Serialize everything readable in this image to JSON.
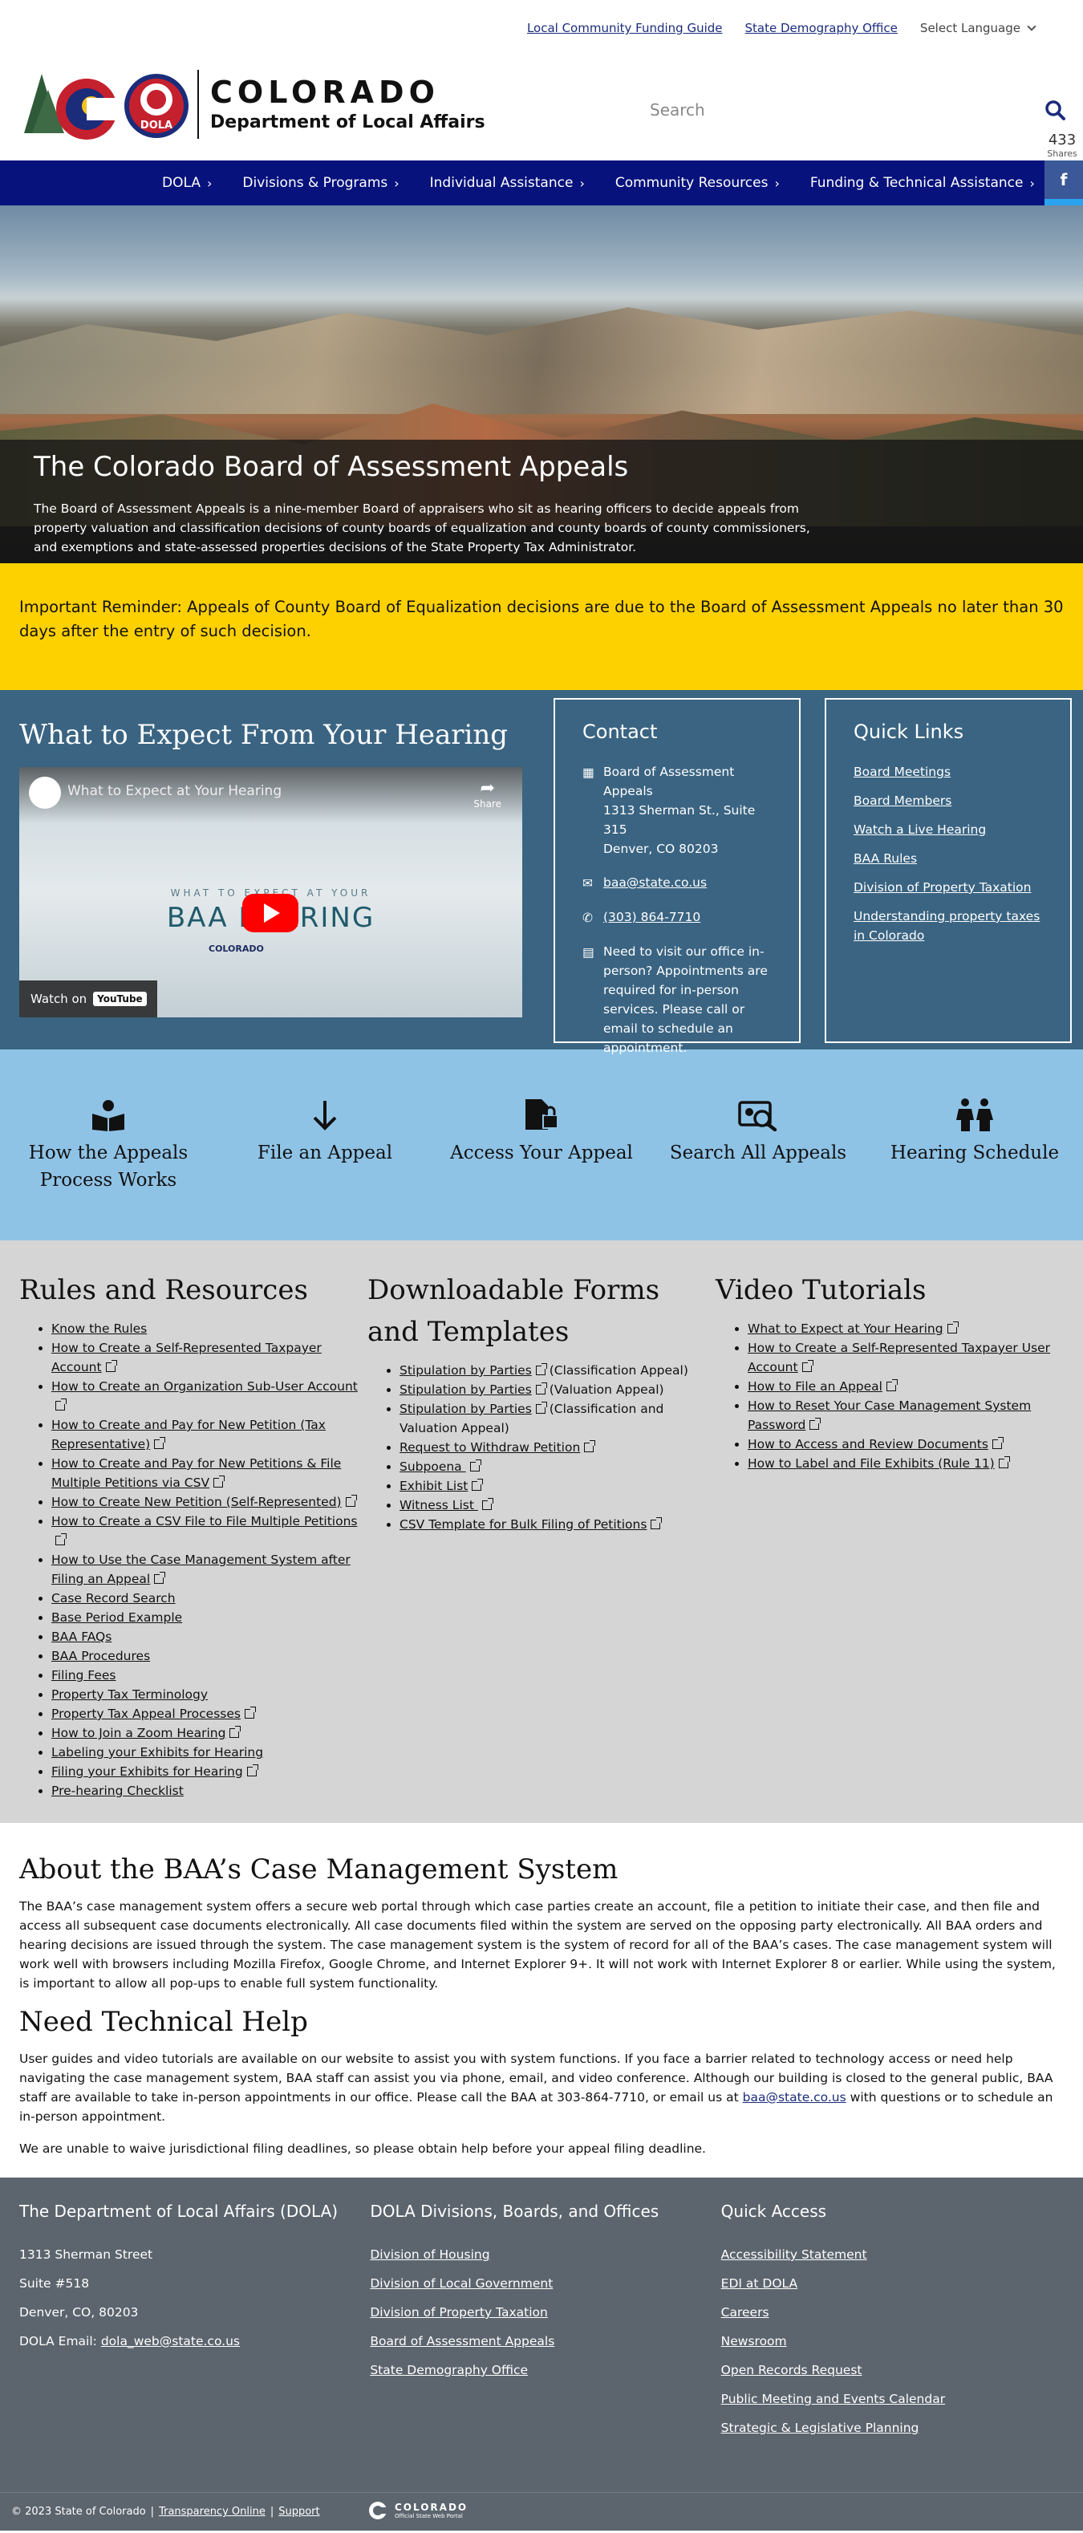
{
  "utility": {
    "links": [
      "Local Community Funding Guide",
      "State Demography Office"
    ],
    "language": "Select Language"
  },
  "header": {
    "logo_line1": "COLORADO",
    "logo_line2": "Department of Local Affairs",
    "logo_badge": "DOLA",
    "search_placeholder": "Search",
    "shares_count": "433",
    "shares_label": "Shares"
  },
  "nav": {
    "items": [
      "DOLA",
      "Divisions & Programs",
      "Individual Assistance",
      "Community Resources",
      "Funding & Technical Assistance"
    ]
  },
  "share_rail": [
    "facebook-icon",
    "twitter-icon",
    "email-icon",
    "share-icon",
    "linkedin-icon"
  ],
  "hero": {
    "title": "The Colorado Board of Assessment Appeals",
    "text": "The Board of Assessment Appeals is a nine-member Board of appraisers who sit as hearing officers to decide appeals from property valuation and classification decisions of county boards of equalization and county boards of county commissioners, and exemptions and state-assessed properties decisions of the State Property Tax Administrator."
  },
  "reminder": "Important Reminder: Appeals of County Board of Equalization decisions are due to the Board of Assessment Appeals no later than 30 days after the entry of such decision.",
  "hearing": {
    "title": "What to Expect From Your Hearing",
    "video_title": "What to Expect at Your Hearing",
    "video_share": "Share",
    "video_caption_small": "WHAT TO EXPECT AT YOUR",
    "video_caption_big": "BAA HEARING",
    "video_logo": "COLORADO",
    "watch_on": "Watch on",
    "youtube": "YouTube"
  },
  "contact": {
    "title": "Contact",
    "address_name": "Board of Assessment Appeals",
    "address_street": "1313 Sherman St., Suite 315",
    "address_city": "Denver, CO 80203",
    "email": "baa@state.co.us",
    "phone": "(303) 864-7710",
    "visit_note": "Need to visit our office in-person? Appointments are required for in-person services. Please call or email to schedule an appointment."
  },
  "quick_links": {
    "title": "Quick Links",
    "items": [
      "Board Meetings",
      "Board Members",
      "Watch a Live Hearing",
      "BAA Rules",
      "Division of Property Taxation",
      "Understanding property taxes in Colorado"
    ]
  },
  "tiles": [
    {
      "label": "How the Appeals Process Works",
      "icon": "book-icon"
    },
    {
      "label": "File an Appeal",
      "icon": "arrow-down-icon"
    },
    {
      "label": "Access Your Appeal",
      "icon": "locked-file-icon"
    },
    {
      "label": "Search All Appeals",
      "icon": "search-id-icon"
    },
    {
      "label": "Hearing Schedule",
      "icon": "people-icon"
    }
  ],
  "rules": {
    "title": "Rules and Resources",
    "items": [
      {
        "text": "Know the Rules",
        "ext": false
      },
      {
        "text": "How to Create a Self-Represented Taxpayer Account",
        "ext": true
      },
      {
        "text": "How to Create an Organization Sub-User Account",
        "ext": true
      },
      {
        "text": "How to Create and Pay for New Petition (Tax Representative)",
        "ext": true
      },
      {
        "text": "How to Create and Pay for New Petitions & File Multiple Petitions via CSV",
        "ext": true
      },
      {
        "text": "How to Create New Petition (Self-Represented)",
        "ext": true
      },
      {
        "text": "How to Create a CSV File to File Multiple Petitions",
        "ext": true
      },
      {
        "text": "How to Use the Case Management System after Filing an Appeal",
        "ext": true
      },
      {
        "text": "Case Record Search",
        "ext": false
      },
      {
        "text": "Base Period Example",
        "ext": false
      },
      {
        "text": "BAA FAQs",
        "ext": false
      },
      {
        "text": "BAA Procedures",
        "ext": false
      },
      {
        "text": "Filing Fees",
        "ext": false
      },
      {
        "text": "Property Tax Terminology",
        "ext": false
      },
      {
        "text": "Property Tax Appeal Processes",
        "ext": true
      },
      {
        "text": "How to Join a Zoom Hearing",
        "ext": true
      },
      {
        "text": "Labeling your Exhibits for Hearing",
        "ext": false
      },
      {
        "text": "Filing your Exhibits for Hearing",
        "ext": true
      },
      {
        "text": "Pre-hearing Checklist",
        "ext": false
      }
    ]
  },
  "forms": {
    "title": "Downloadable Forms and Templates",
    "items": [
      {
        "text": "Stipulation by Parties",
        "ext": true,
        "suffix": " (Classification Appeal)"
      },
      {
        "text": "Stipulation by Parties",
        "ext": true,
        "suffix": " (Valuation Appeal)"
      },
      {
        "text": "Stipulation by Parties",
        "ext": true,
        "suffix": " (Classification and Valuation Appeal)"
      },
      {
        "text": "Request to Withdraw Petition",
        "ext": true,
        "suffix": ""
      },
      {
        "text": "Subpoena ",
        "ext": true,
        "suffix": ""
      },
      {
        "text": "Exhibit List",
        "ext": true,
        "suffix": ""
      },
      {
        "text": "Witness List ",
        "ext": true,
        "suffix": ""
      },
      {
        "text": "CSV Template for Bulk Filing of Petitions",
        "ext": true,
        "suffix": ""
      }
    ]
  },
  "videos": {
    "title": "Video Tutorials",
    "items": [
      {
        "text": "What to Expect at Your Hearing",
        "ext": true
      },
      {
        "text": "How to Create a Self-Represented Taxpayer User Account",
        "ext": true
      },
      {
        "text": "How to File an Appeal",
        "ext": true
      },
      {
        "text": "How to Reset Your Case Management System Password",
        "ext": true
      },
      {
        "text": "How to Access and Review Documents",
        "ext": true
      },
      {
        "text": "How to Label and File Exhibits (Rule 11)",
        "ext": true
      }
    ]
  },
  "about": {
    "title": "About the BAA’s Case Management System",
    "text": "The BAA’s case management system offers a secure web portal through which case parties create an account, file a petition to initiate their case, and then file and access all subsequent case documents electronically. All case documents filed within the system are served on the opposing party electronically. All BAA orders and hearing decisions are issued through the system. The case management system is the system of record for all of the BAA’s cases. The case management system will work well with browsers including Mozilla Firefox, Google Chrome, and Internet Explorer 9+. It will not work with Internet Explorer 8 or earlier. While using the system, is important to allow all pop-ups to enable full system functionality.",
    "help_title": "Need Technical Help",
    "help_text_before": "User guides and video tutorials are available on our website to assist you with system functions. If you face a barrier related to technology access or need help navigating the case management system, BAA staff can assist you via phone, email, and video conference. Although our building is closed to the general public, BAA staff are available to take in-person appointments in our office. Please call the BAA at 303-864-7710, or email us at ",
    "help_email": "baa@state.co.us",
    "help_text_after": " with questions or to schedule an in-person appointment.",
    "deadline_note": "We are unable to waive jurisdictional filing deadlines, so please obtain help before your appeal filing deadline."
  },
  "footer": {
    "col1_title": "The Department of Local Affairs (DOLA)",
    "address1": "1313 Sherman Street",
    "address2": "Suite  #518",
    "address3": "Denver, CO, 80203",
    "email_label": "DOLA Email: ",
    "email": "dola_web@state.co.us",
    "col2_title": "DOLA Divisions, Boards, and Offices",
    "col2_links": [
      "Division of Housing",
      "Division of Local Government",
      "Division of Property Taxation",
      "Board of Assessment Appeals",
      "State Demography Office"
    ],
    "col3_title": "Quick Access",
    "col3_links": [
      "Accessibility Statement",
      "EDI at DOLA",
      "Careers",
      "Newsroom",
      "Open Records Request",
      "Public Meeting and Events Calendar",
      "Strategic & Legislative Planning"
    ]
  },
  "subfooter": {
    "copyright": "© 2023 State of Colorado",
    "links": [
      "Transparency Online",
      "Support"
    ],
    "portal_name": "COLORADO",
    "portal_sub": "Official State Web Portal"
  }
}
